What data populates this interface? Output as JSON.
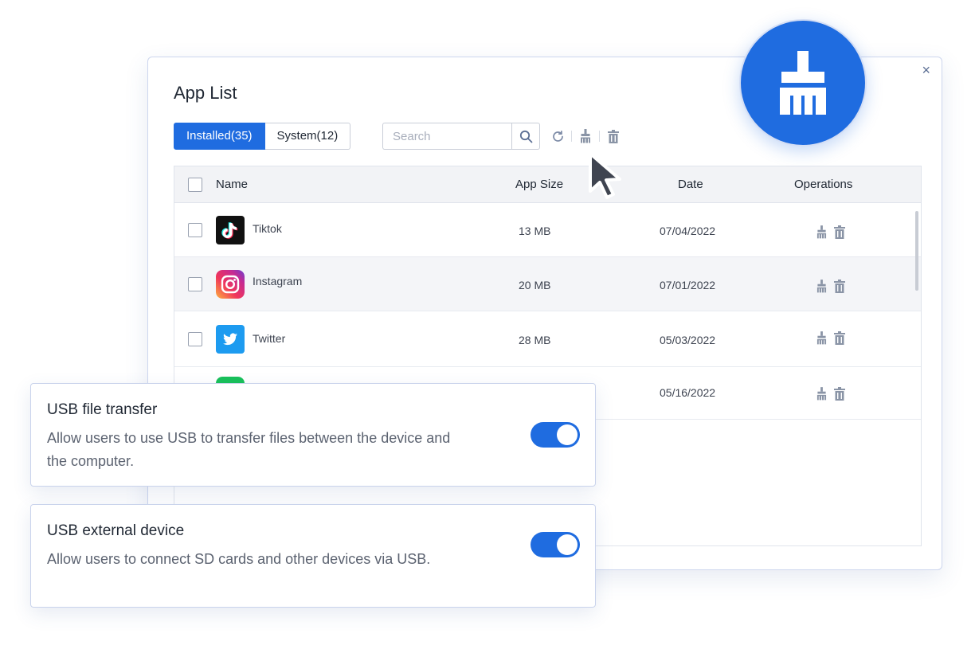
{
  "window": {
    "title": "App List",
    "close_glyph": "×"
  },
  "tabs": [
    {
      "label": "Installed(35)",
      "active": true
    },
    {
      "label": "System(12)",
      "active": false
    }
  ],
  "search": {
    "placeholder": "Search",
    "value": ""
  },
  "toolbar": {
    "icons": [
      "refresh-icon",
      "clean-broom-icon",
      "trash-icon"
    ]
  },
  "table": {
    "columns": {
      "name": "Name",
      "size": "App Size",
      "date": "Date",
      "ops": "Operations"
    },
    "rows": [
      {
        "name": "Tiktok",
        "size": "13 MB",
        "date": "07/04/2022",
        "icon": "tiktok-icon"
      },
      {
        "name": "Instagram",
        "size": "20 MB",
        "date": "07/01/2022",
        "icon": "instagram-icon"
      },
      {
        "name": "Twitter",
        "size": "28 MB",
        "date": "05/03/2022",
        "icon": "twitter-icon"
      },
      {
        "name": "",
        "size": "",
        "date": "05/16/2022",
        "icon": "green-app-icon"
      }
    ]
  },
  "badge": {
    "icon": "clean-broom-icon"
  },
  "cards": [
    {
      "title": "USB file transfer",
      "description": "Allow users to use USB to transfer files between the device and the computer.",
      "enabled": true
    },
    {
      "title": "USB external device",
      "description": "Allow users to connect SD cards and other devices via USB.",
      "enabled": true
    }
  ],
  "colors": {
    "accent": "#1f6ce0",
    "icon_gray": "#8a94a6",
    "border": "#c9d3ec"
  }
}
